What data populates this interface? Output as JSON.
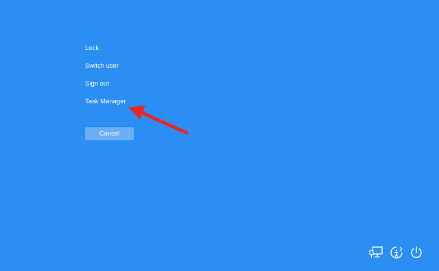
{
  "menu": {
    "items": [
      {
        "label": "Lock"
      },
      {
        "label": "Switch user"
      },
      {
        "label": "Sign out"
      },
      {
        "label": "Task Manager"
      }
    ]
  },
  "cancel": {
    "label": "Cancel"
  },
  "tray": {
    "icons": [
      "network-icon",
      "ease-of-access-icon",
      "power-icon"
    ]
  },
  "colors": {
    "background": "#2a8ef2",
    "button_background": "#6aaef5",
    "text": "#ffffff",
    "annotation_arrow": "#e8262a"
  }
}
